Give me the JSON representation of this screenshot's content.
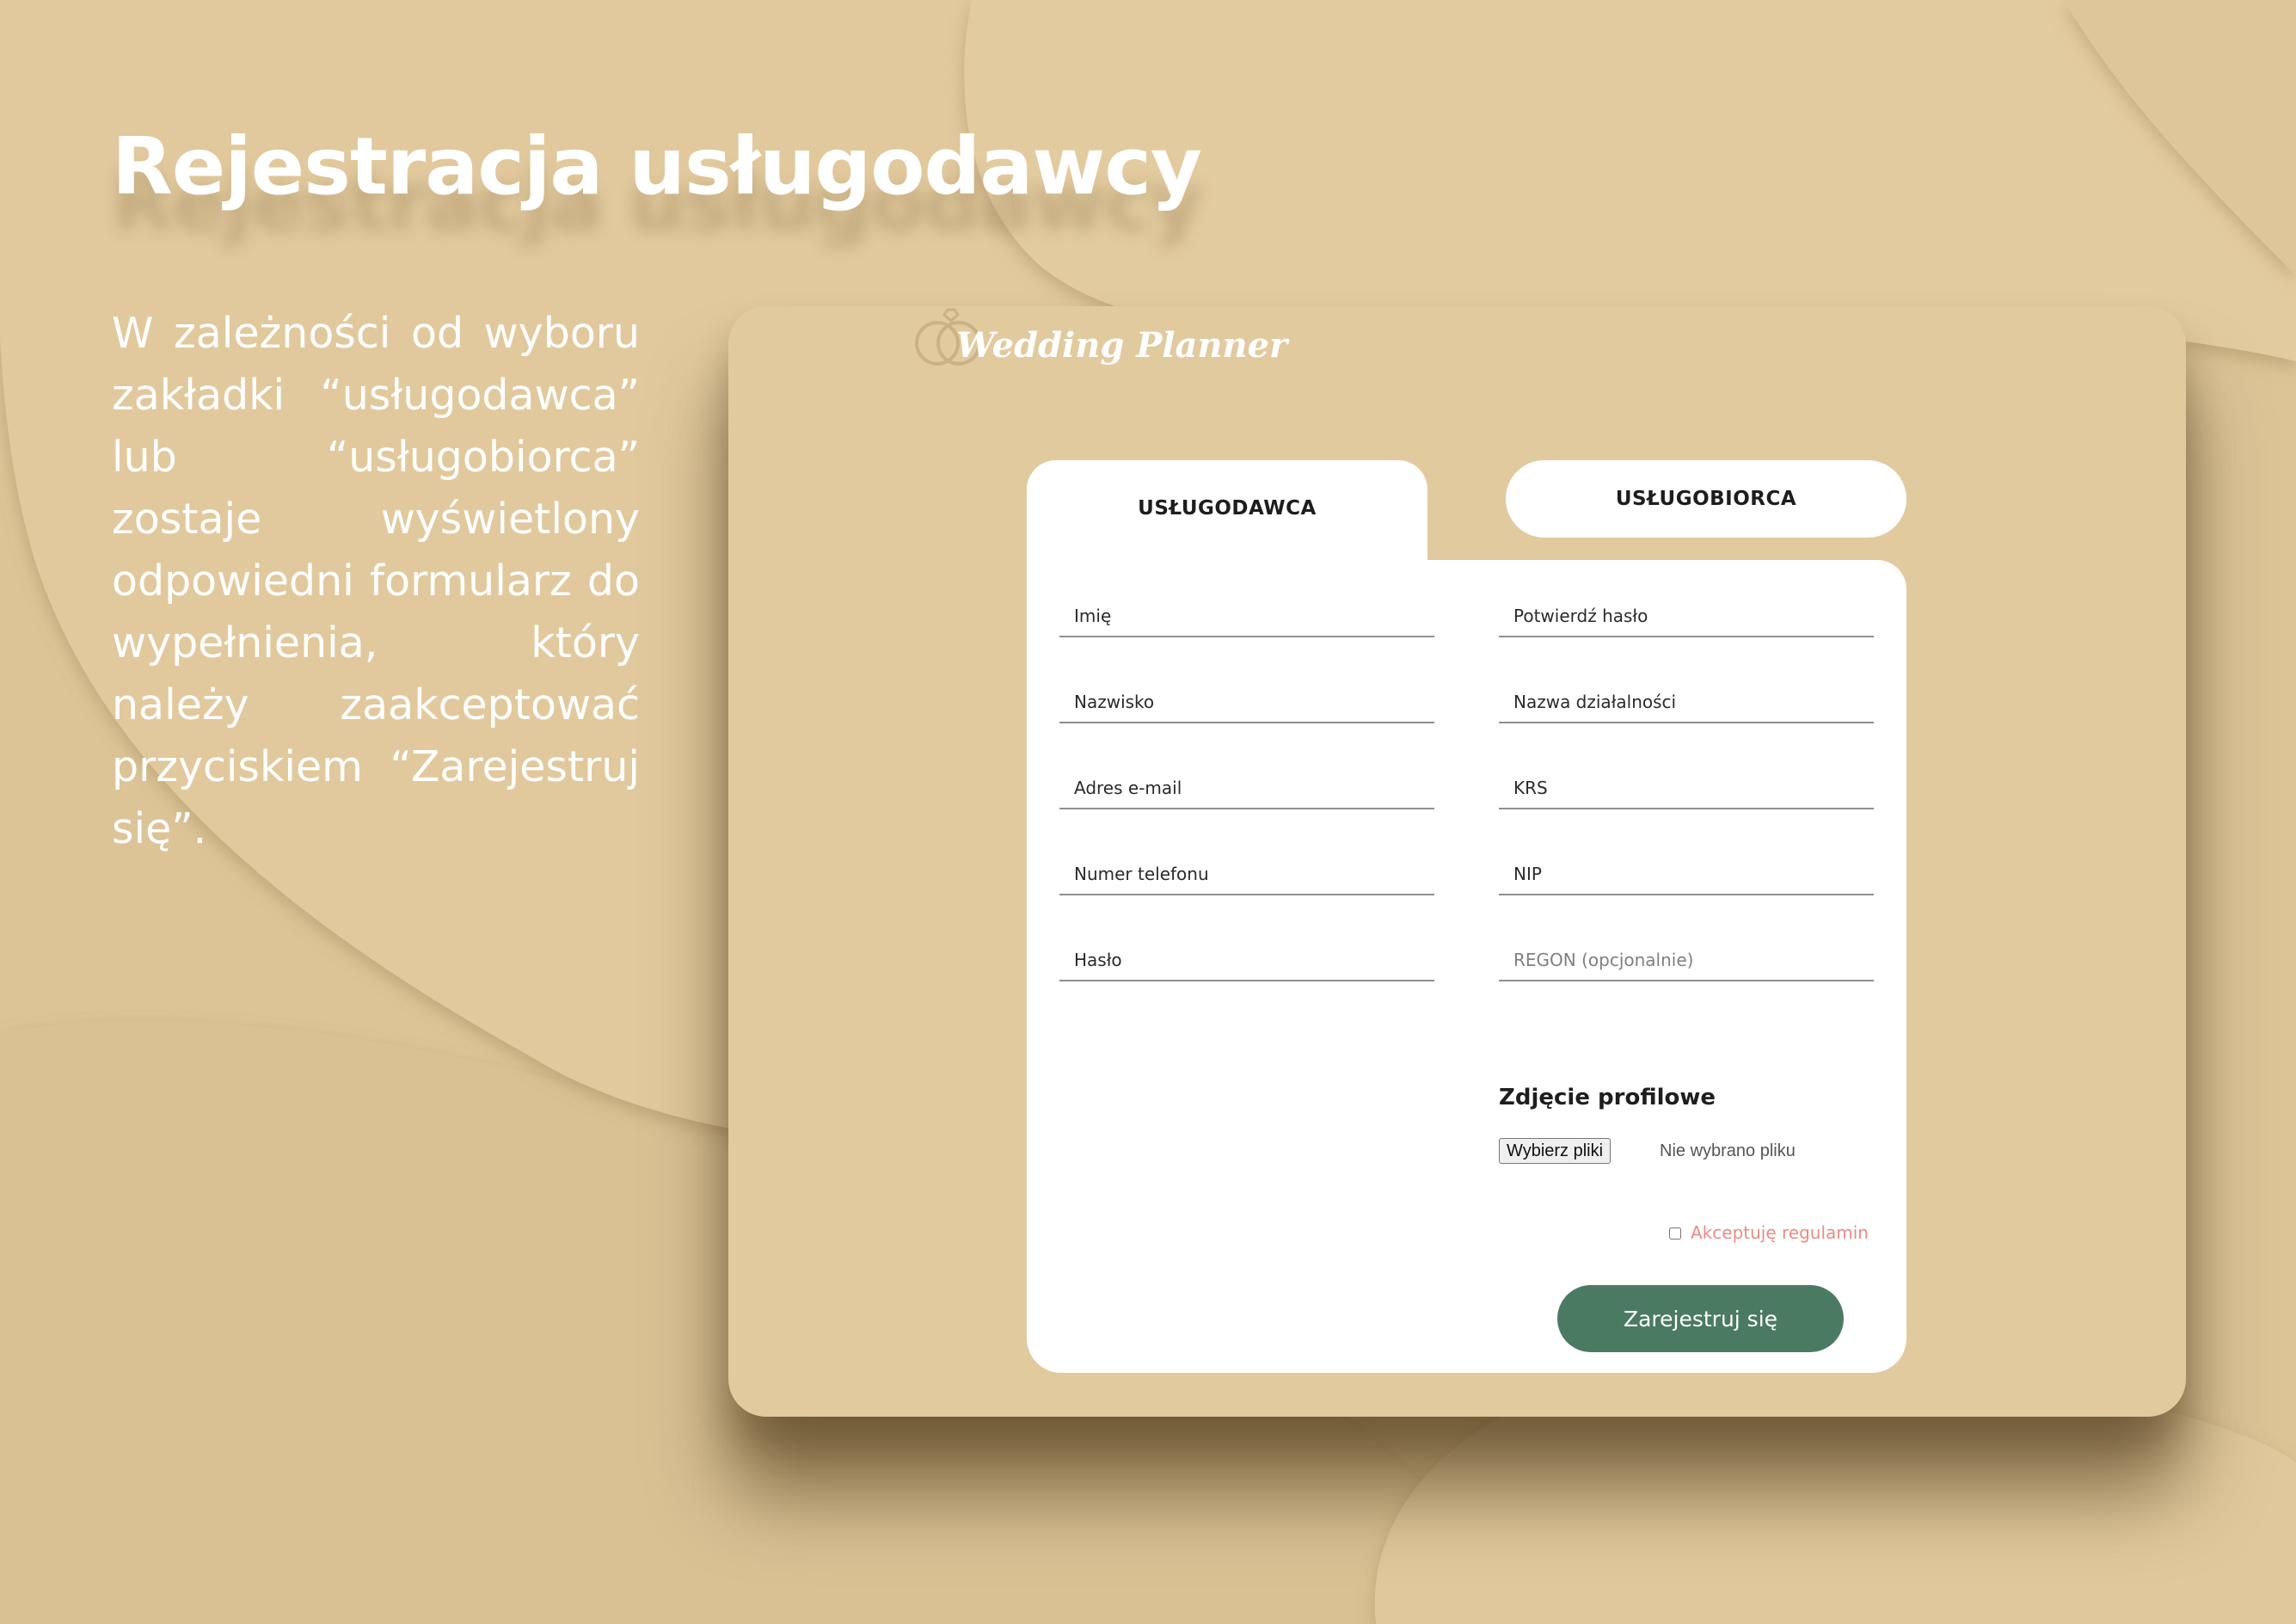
{
  "slide": {
    "title": "Rejestracja usługodawcy",
    "description": "W zależności od wyboru zakładki “usługodawca” lub “usługobiorca” zostaje wyświetlony odpowiedni formularz do wypełnienia, który należy zaakceptować przyciskiem “Zarejestruj się”."
  },
  "app": {
    "logo_text": "Wedding Planner",
    "tabs": [
      {
        "label": "USŁUGODAWCA",
        "active": true
      },
      {
        "label": "USŁUGOBIORCA",
        "active": false
      }
    ],
    "form": {
      "left_fields": [
        "Imię",
        "Nazwisko",
        "Adres e-mail",
        "Numer telefonu",
        "Hasło"
      ],
      "right_fields": [
        "Potwierdź hasło",
        "Nazwa działalności",
        "KRS",
        "NIP",
        "REGON (opcjonalnie)"
      ],
      "profile_photo_label": "Zdjęcie profilowe",
      "file_button_label": "Wybierz pliki",
      "file_status": "Nie wybrano pliku",
      "terms_label": "Akceptuję regulamin",
      "submit_label": "Zarejestruj się"
    }
  },
  "colors": {
    "background": "#dfc79c",
    "card": "#e2ca9f",
    "accent": "#4b7a62",
    "terms_text": "#e88c86"
  }
}
